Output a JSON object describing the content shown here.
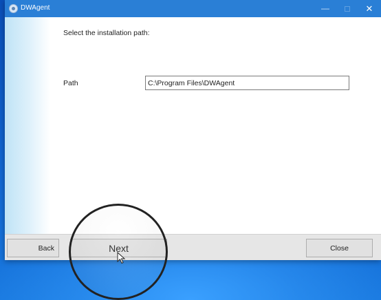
{
  "window": {
    "title": "DWAgent",
    "minimize_glyph": "—",
    "close_glyph": "✕"
  },
  "content": {
    "instruction": "Select the installation path:",
    "path_label": "Path",
    "path_value": "C:\\Program Files\\DWAgent"
  },
  "buttons": {
    "back": "Back",
    "next": "Next",
    "close": "Close"
  },
  "icons": {
    "app": "dwagent-app-icon",
    "cursor": "mouse-pointer-icon",
    "magnifier": "zoom-lens"
  },
  "colors": {
    "titlebar": "#2a7fd6",
    "desktop": "#0a4fb8",
    "button_bar": "#e6e6e6"
  }
}
